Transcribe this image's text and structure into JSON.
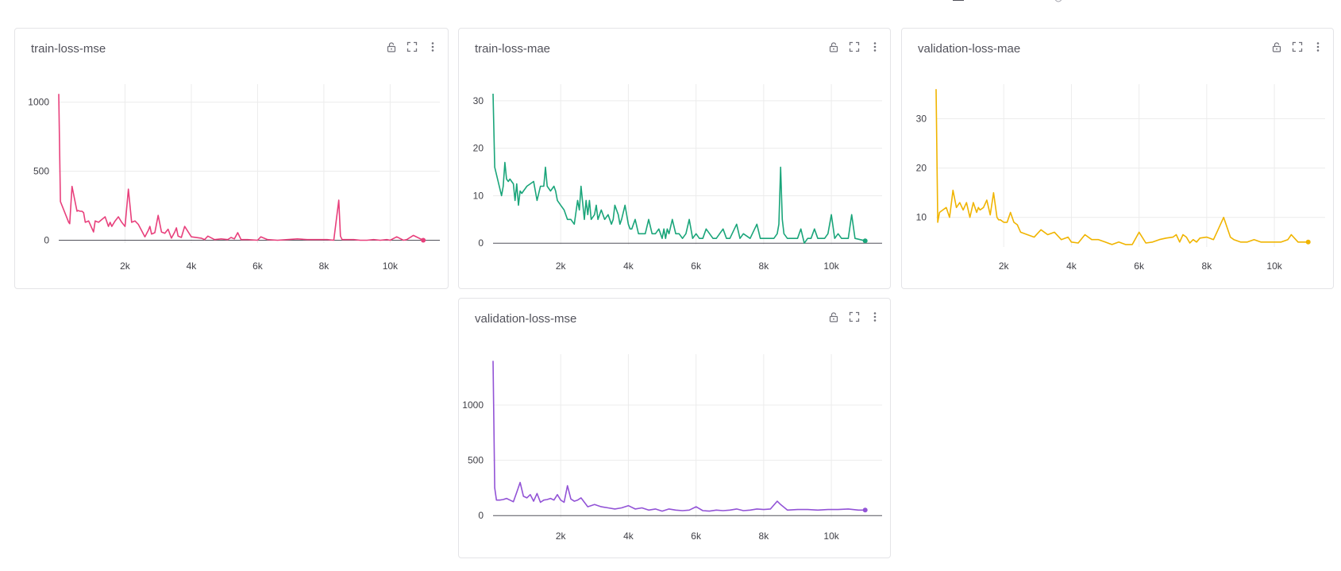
{
  "icons": {
    "lock": "lock-open-icon",
    "expand": "expand-icon",
    "more": "more-vertical-icon"
  },
  "colors": {
    "pink": "#e8407c",
    "green": "#1aa57a",
    "yellow": "#f0b400",
    "purple": "#9253d6"
  },
  "chart_data": [
    {
      "type": "line",
      "title": "train-loss-mse",
      "color": "#e8407c",
      "xlim": [
        0,
        11500
      ],
      "ylim": [
        -20,
        1130
      ],
      "xticks": [
        {
          "v": 2000,
          "label": "2k"
        },
        {
          "v": 4000,
          "label": "4k"
        },
        {
          "v": 6000,
          "label": "6k"
        },
        {
          "v": 8000,
          "label": "8k"
        },
        {
          "v": 10000,
          "label": "10k"
        }
      ],
      "yticks": [
        {
          "v": 0,
          "label": "0"
        },
        {
          "v": 500,
          "label": "500"
        },
        {
          "v": 1000,
          "label": "1000"
        }
      ],
      "x": [
        0,
        50,
        150,
        300,
        330,
        400,
        550,
        580,
        650,
        700,
        750,
        800,
        900,
        1050,
        1100,
        1200,
        1300,
        1400,
        1500,
        1550,
        1600,
        1700,
        1800,
        1900,
        2000,
        2100,
        2200,
        2300,
        2400,
        2500,
        2600,
        2700,
        2750,
        2800,
        2900,
        3000,
        3100,
        3200,
        3300,
        3400,
        3500,
        3550,
        3600,
        3700,
        3800,
        4000,
        4300,
        4400,
        4500,
        4700,
        4900,
        5100,
        5200,
        5300,
        5400,
        5500,
        5700,
        6000,
        6100,
        6300,
        6600,
        6900,
        7200,
        7500,
        7800,
        8100,
        8300,
        8450,
        8500,
        8550,
        8700,
        8900,
        9100,
        9300,
        9500,
        9700,
        9900,
        10000,
        10200,
        10400,
        10500,
        10700,
        11000
      ],
      "y": [
        1060,
        280,
        220,
        130,
        120,
        390,
        210,
        215,
        210,
        210,
        200,
        130,
        140,
        60,
        140,
        130,
        150,
        170,
        100,
        130,
        100,
        140,
        170,
        130,
        100,
        370,
        130,
        140,
        115,
        70,
        25,
        70,
        100,
        45,
        55,
        180,
        60,
        50,
        80,
        15,
        60,
        90,
        30,
        20,
        100,
        25,
        15,
        5,
        30,
        5,
        10,
        5,
        20,
        10,
        55,
        5,
        5,
        0,
        25,
        5,
        0,
        5,
        10,
        5,
        5,
        5,
        0,
        290,
        30,
        5,
        5,
        5,
        0,
        0,
        5,
        0,
        5,
        0,
        25,
        0,
        5,
        35,
        0
      ]
    },
    {
      "type": "line",
      "title": "train-loss-mae",
      "color": "#1aa57a",
      "xlim": [
        0,
        11500
      ],
      "ylim": [
        -0.3,
        33.5
      ],
      "xticks": [
        {
          "v": 2000,
          "label": "2k"
        },
        {
          "v": 4000,
          "label": "4k"
        },
        {
          "v": 6000,
          "label": "6k"
        },
        {
          "v": 8000,
          "label": "8k"
        },
        {
          "v": 10000,
          "label": "10k"
        }
      ],
      "yticks": [
        {
          "v": 0,
          "label": "0"
        },
        {
          "v": 10,
          "label": "10"
        },
        {
          "v": 20,
          "label": "20"
        },
        {
          "v": 30,
          "label": "30"
        }
      ],
      "x": [
        0,
        50,
        150,
        250,
        300,
        350,
        400,
        450,
        500,
        550,
        600,
        650,
        700,
        750,
        800,
        850,
        900,
        950,
        1000,
        1100,
        1200,
        1300,
        1400,
        1500,
        1550,
        1600,
        1700,
        1800,
        1850,
        1900,
        2000,
        2100,
        2200,
        2300,
        2400,
        2500,
        2550,
        2600,
        2700,
        2750,
        2800,
        2850,
        2900,
        3000,
        3050,
        3100,
        3200,
        3300,
        3400,
        3500,
        3550,
        3600,
        3700,
        3750,
        3800,
        3900,
        4000,
        4050,
        4100,
        4200,
        4300,
        4400,
        4500,
        4600,
        4700,
        4800,
        4900,
        5000,
        5050,
        5100,
        5150,
        5200,
        5300,
        5400,
        5500,
        5600,
        5700,
        5800,
        5900,
        6000,
        6100,
        6200,
        6300,
        6500,
        6600,
        6800,
        6900,
        7000,
        7200,
        7300,
        7400,
        7600,
        7800,
        7900,
        8000,
        8100,
        8200,
        8300,
        8400,
        8450,
        8500,
        8550,
        8600,
        8700,
        8900,
        9000,
        9100,
        9200,
        9300,
        9400,
        9500,
        9600,
        9700,
        9800,
        9900,
        10000,
        10100,
        10200,
        10300,
        10400,
        10500,
        10600,
        10700,
        11000
      ],
      "y": [
        31.5,
        16,
        13,
        10,
        12,
        17,
        13.5,
        13,
        13.5,
        13,
        12.5,
        9,
        12.5,
        8,
        11,
        10.5,
        11,
        11.5,
        12,
        12.5,
        13,
        9,
        12,
        12,
        16,
        12,
        11,
        12,
        11,
        9,
        8,
        7,
        5,
        5,
        4,
        9,
        7,
        12,
        5,
        9,
        6,
        9,
        5,
        6,
        8,
        5,
        7,
        5,
        6,
        4,
        5,
        8,
        6,
        4,
        5,
        8,
        4,
        3,
        3,
        5,
        2,
        2,
        2,
        5,
        2,
        2,
        3,
        1,
        3,
        1,
        3,
        2,
        5,
        2,
        2,
        1,
        2,
        5,
        1,
        2,
        1,
        1,
        3,
        1,
        1,
        3,
        1,
        1,
        4,
        1,
        2,
        1,
        4,
        1,
        1,
        1,
        1,
        1,
        2,
        4,
        16,
        5,
        2,
        1,
        1,
        1,
        3,
        0,
        1,
        1,
        3,
        1,
        1,
        1,
        2,
        6,
        1,
        2,
        1,
        1,
        1,
        6,
        1,
        0.5
      ]
    },
    {
      "type": "line",
      "title": "validation-loss-mae",
      "color": "#f0b400",
      "xlim": [
        0,
        11500
      ],
      "ylim": [
        4,
        37
      ],
      "xticks": [
        {
          "v": 2000,
          "label": "2k"
        },
        {
          "v": 4000,
          "label": "4k"
        },
        {
          "v": 6000,
          "label": "6k"
        },
        {
          "v": 8000,
          "label": "8k"
        },
        {
          "v": 10000,
          "label": "10k"
        }
      ],
      "yticks": [
        {
          "v": 10,
          "label": "10"
        },
        {
          "v": 20,
          "label": "20"
        },
        {
          "v": 30,
          "label": "30"
        }
      ],
      "x": [
        0,
        50,
        100,
        200,
        300,
        400,
        500,
        600,
        700,
        800,
        900,
        1000,
        1100,
        1200,
        1250,
        1300,
        1400,
        1500,
        1600,
        1700,
        1800,
        1850,
        1900,
        2000,
        2100,
        2200,
        2300,
        2400,
        2500,
        2700,
        2900,
        3100,
        3300,
        3500,
        3700,
        3900,
        4000,
        4200,
        4400,
        4600,
        4800,
        5000,
        5200,
        5400,
        5600,
        5800,
        6000,
        6200,
        6400,
        6600,
        6800,
        7000,
        7100,
        7200,
        7300,
        7400,
        7500,
        7600,
        7700,
        7800,
        8000,
        8200,
        8300,
        8500,
        8700,
        8800,
        9000,
        9200,
        9400,
        9600,
        9800,
        10000,
        10200,
        10400,
        10500,
        10700,
        11000
      ],
      "y": [
        36,
        9,
        11,
        11.5,
        12,
        10,
        15.5,
        12,
        13,
        11.5,
        13,
        10,
        13,
        11,
        12,
        11.5,
        12,
        13.5,
        10.5,
        15,
        10,
        9.5,
        9.5,
        9,
        9,
        11,
        9,
        8.5,
        7,
        6.5,
        6,
        7.5,
        6.5,
        7,
        5.5,
        6,
        5,
        4.8,
        6.5,
        5.5,
        5.5,
        5,
        4.5,
        5,
        4.5,
        4.5,
        7,
        4.8,
        5,
        5.5,
        5.8,
        6,
        6.5,
        5,
        6.5,
        6,
        4.8,
        5.5,
        5,
        5.8,
        6,
        5.5,
        7,
        10,
        6,
        5.5,
        5,
        5,
        5.5,
        5,
        5,
        5,
        5,
        5.5,
        6.5,
        5,
        5
      ]
    },
    {
      "type": "line",
      "title": "validation-loss-mse",
      "color": "#9253d6",
      "xlim": [
        0,
        11500
      ],
      "ylim": [
        -20,
        1460
      ],
      "xticks": [
        {
          "v": 2000,
          "label": "2k"
        },
        {
          "v": 4000,
          "label": "4k"
        },
        {
          "v": 6000,
          "label": "6k"
        },
        {
          "v": 8000,
          "label": "8k"
        },
        {
          "v": 10000,
          "label": "10k"
        }
      ],
      "yticks": [
        {
          "v": 0,
          "label": "0"
        },
        {
          "v": 500,
          "label": "500"
        },
        {
          "v": 1000,
          "label": "1000"
        }
      ],
      "x": [
        0,
        50,
        100,
        200,
        300,
        400,
        500,
        600,
        700,
        800,
        900,
        1000,
        1100,
        1200,
        1300,
        1400,
        1500,
        1600,
        1700,
        1800,
        1900,
        2000,
        2100,
        2200,
        2300,
        2400,
        2500,
        2600,
        2800,
        3000,
        3200,
        3400,
        3600,
        3800,
        4000,
        4200,
        4400,
        4600,
        4800,
        5000,
        5200,
        5400,
        5600,
        5800,
        6000,
        6200,
        6400,
        6600,
        6800,
        7000,
        7200,
        7400,
        7600,
        7800,
        8000,
        8200,
        8400,
        8500,
        8700,
        9000,
        9300,
        9600,
        9900,
        10200,
        10500,
        10800,
        11000
      ],
      "y": [
        1400,
        250,
        140,
        140,
        145,
        155,
        140,
        125,
        210,
        300,
        175,
        160,
        190,
        130,
        200,
        120,
        140,
        145,
        155,
        140,
        190,
        140,
        120,
        270,
        150,
        130,
        140,
        160,
        80,
        100,
        80,
        70,
        60,
        70,
        90,
        60,
        70,
        50,
        60,
        40,
        60,
        50,
        45,
        50,
        80,
        45,
        40,
        50,
        45,
        50,
        60,
        45,
        50,
        60,
        55,
        60,
        130,
        100,
        50,
        55,
        55,
        50,
        55,
        55,
        60,
        50,
        50
      ]
    }
  ]
}
